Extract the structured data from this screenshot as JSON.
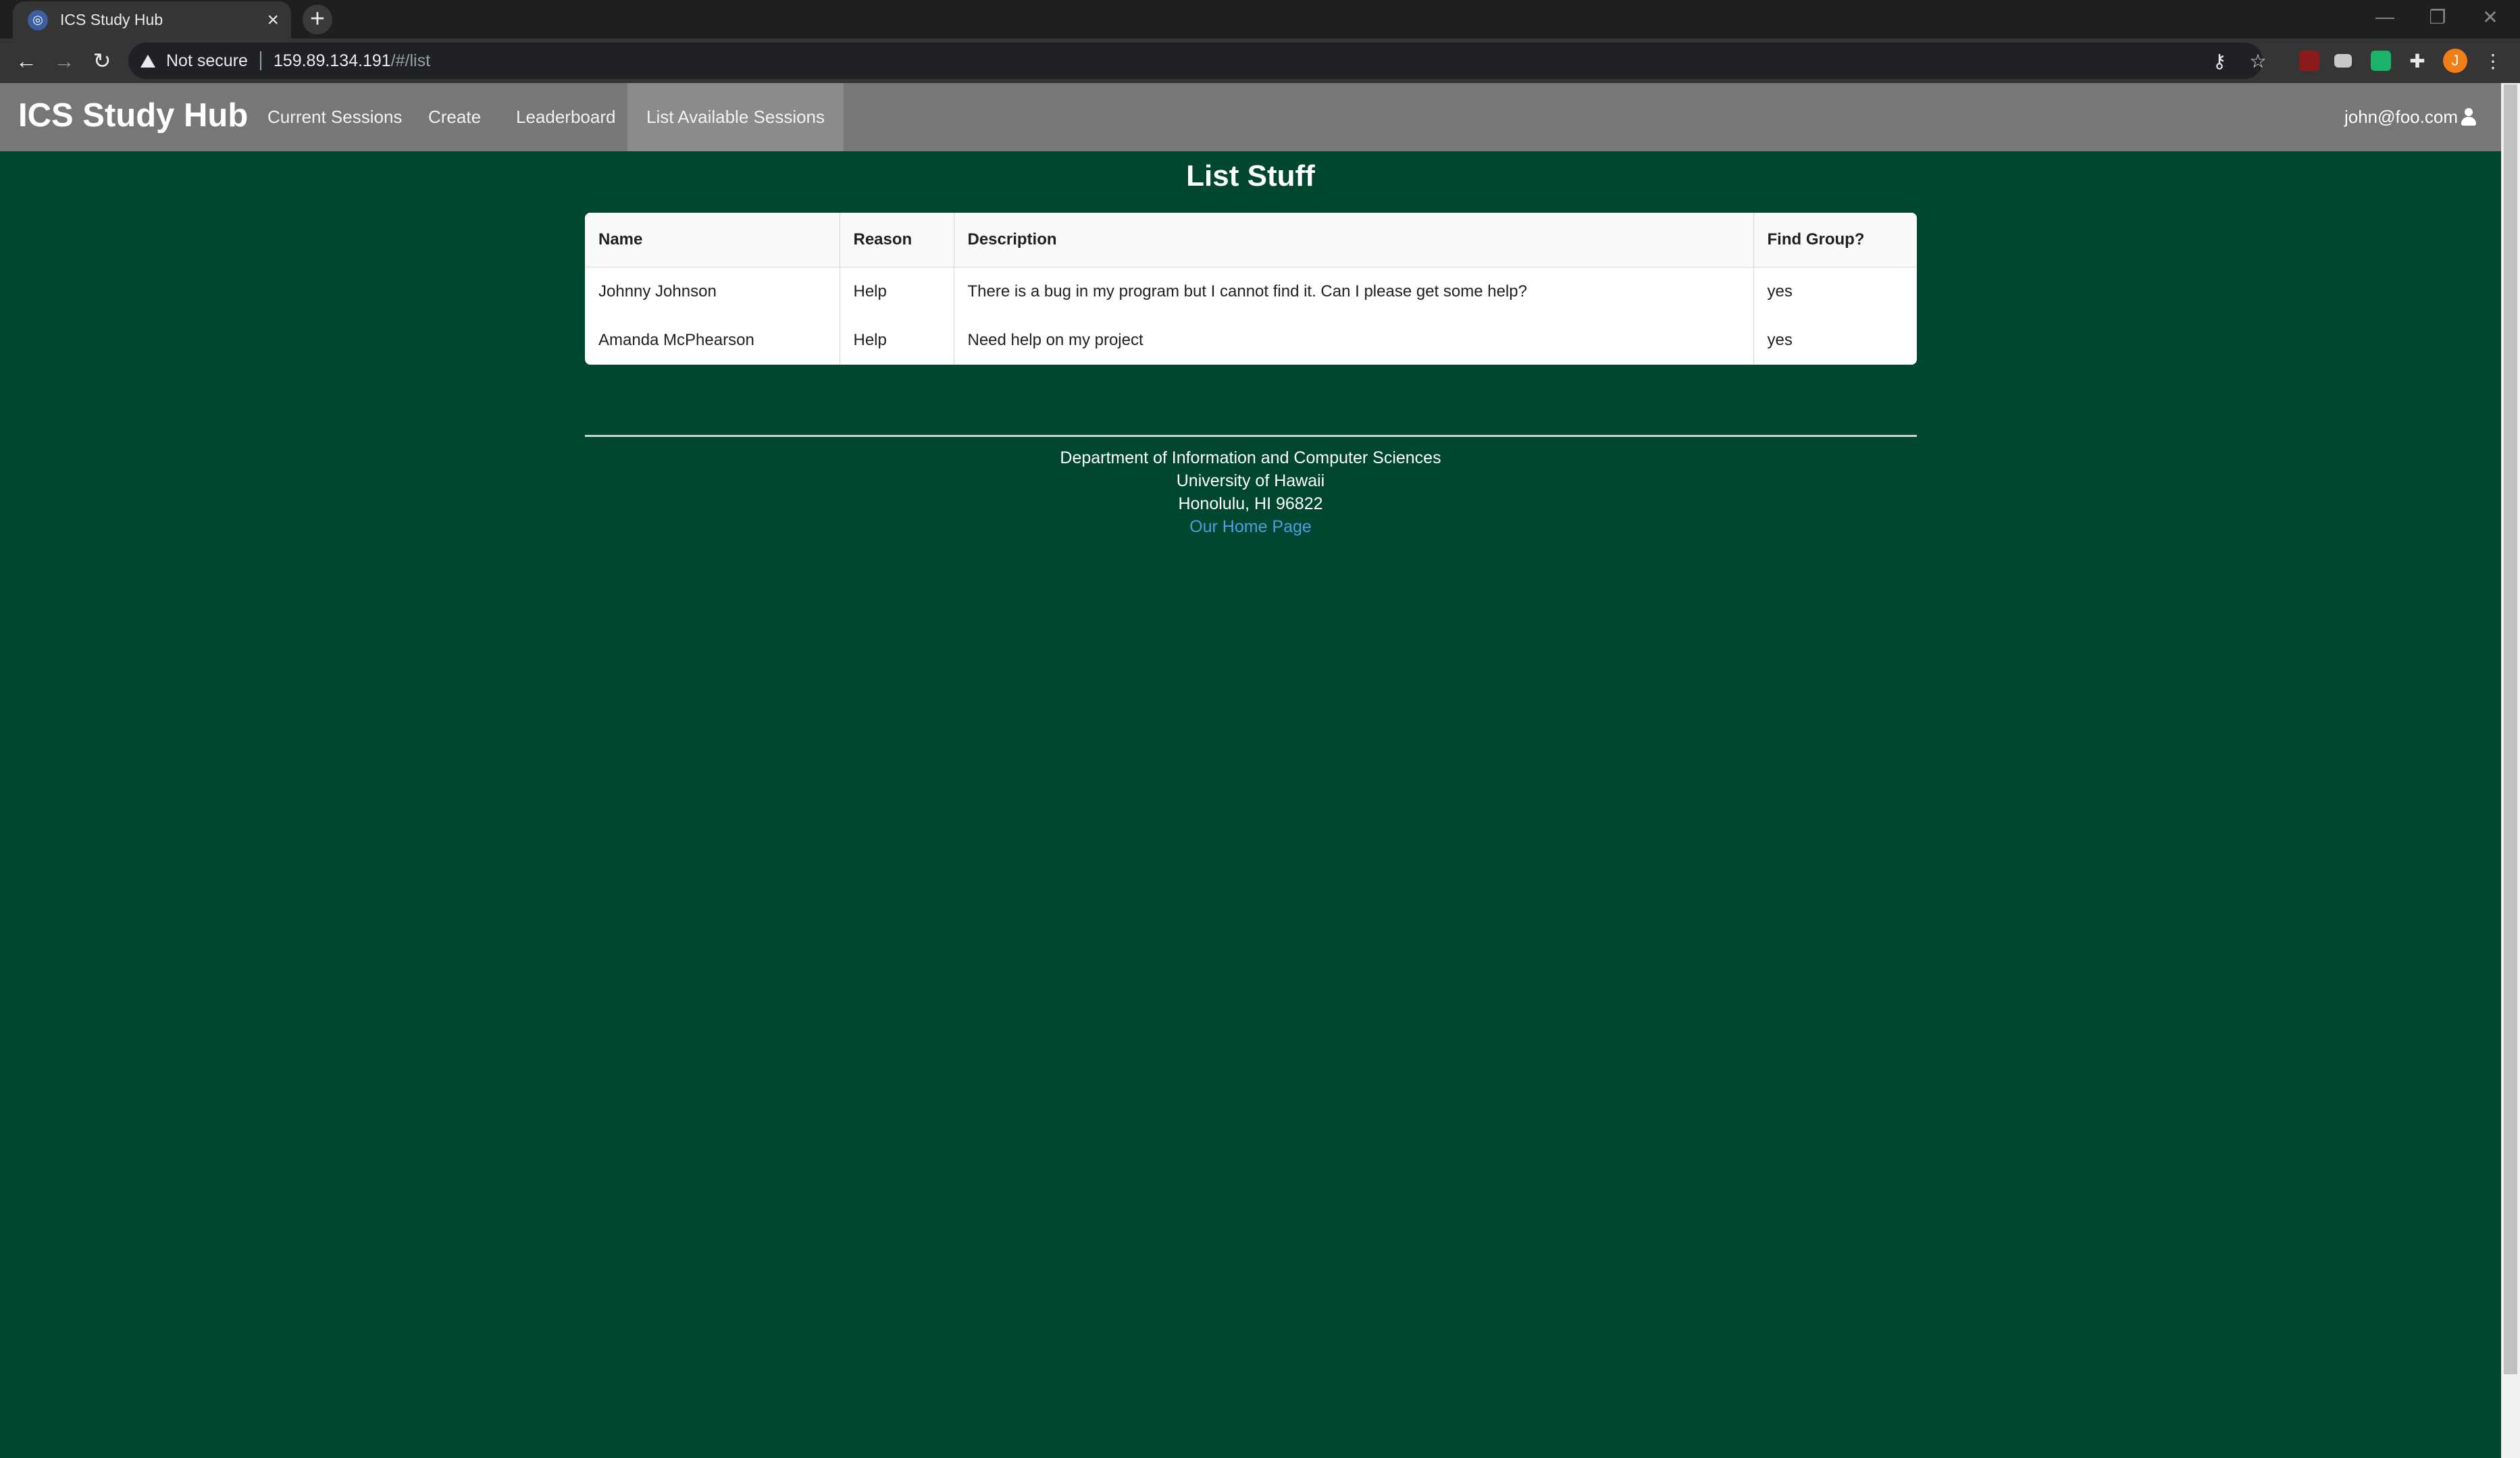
{
  "browser": {
    "tab_title": "ICS Study Hub",
    "tab_close": "×",
    "new_tab": "+",
    "not_secure": "Not secure",
    "url_host": "159.89.134.191",
    "url_path": "/#/list",
    "profile_initial": "J"
  },
  "navbar": {
    "brand": "ICS Study Hub",
    "links": [
      "Current Sessions",
      "Create",
      "Leaderboard",
      "List Available Sessions"
    ],
    "active_link": "List Available Sessions",
    "user": "john@foo.com"
  },
  "main": {
    "title": "List Stuff",
    "table": {
      "headers": [
        "Name",
        "Reason",
        "Description",
        "Find Group?"
      ],
      "rows": [
        [
          "Johnny Johnson",
          "Help",
          "There is a bug in my program but I cannot find it. Can I please get some help?",
          "yes"
        ],
        [
          "Amanda McPhearson",
          "Help",
          "Need help on my project",
          "yes"
        ]
      ]
    }
  },
  "footer": {
    "line1": "Department of Information and Computer Sciences",
    "line2": "University of Hawaii",
    "line3": "Honolulu, HI 96822",
    "link": "Our Home Page"
  },
  "colors": {
    "page_background": "#004631",
    "navbar": "#777777",
    "footer_link": "#4d9fe0"
  }
}
